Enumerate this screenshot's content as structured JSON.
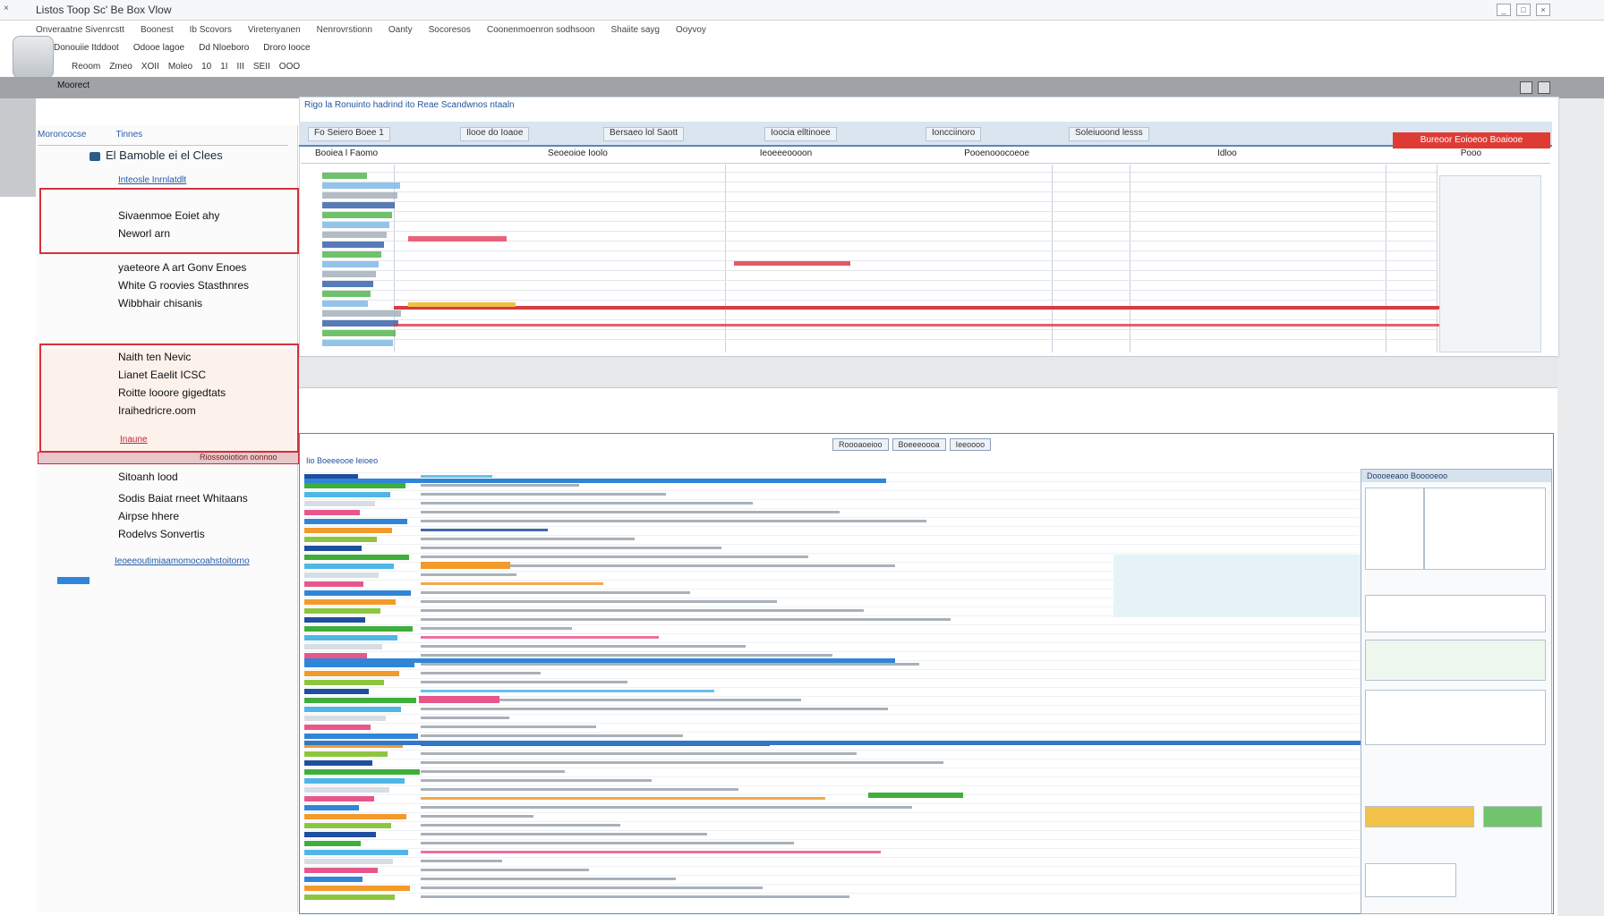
{
  "window": {
    "title": "Listos Toop Sc' Be Box Vlow",
    "controls": [
      "_",
      "□",
      "×"
    ]
  },
  "menubar": [
    "Onveraatne Sivenrcstt",
    "Boonest",
    "Ib Scovors",
    "Viretenyanen",
    "Nenrovrstionn",
    "Oanty",
    "Socoresos",
    "Coonenmoenron sodhsoon",
    "Shaiite sayg",
    "Ooyvoy"
  ],
  "toolbar2": [
    "Donouiie Itddoot",
    "Odooe lagoe",
    "Dd Nloeboro",
    "Droro Iooce"
  ],
  "toolbar3": [
    "Reoom",
    "Zmeo",
    "XOII",
    "Moleo",
    "10",
    "1I",
    "III",
    "SEII",
    "OOO"
  ],
  "graybar": {
    "label": "Moorect"
  },
  "nav": {
    "tabs": [
      "Moroncocse",
      "Tinnes"
    ],
    "header": "El Bamoble ei el Clees",
    "top_link": "Inteosle Inrnlatdlt",
    "group1": [
      "Sivaenmoe Eoiet ahy",
      "Neworl arn"
    ],
    "group2": [
      "yaeteore A art Gonv Enoes",
      "White G roovies Stasthnres",
      "Wibbhair chisanis"
    ],
    "group3": [
      "Naith ten Nevic",
      "Lianet Eaelit ICSC",
      "Roitte looore gigedtats",
      "Iraihedricre.oom"
    ],
    "red_link": "Inaune",
    "red_row": "Riossooiotion oonnoo",
    "group4": [
      "Sitoanh lood",
      "Sodis Baiat rneet Whitaans",
      "Airpse hhere",
      "Rodelvs Sonvertis"
    ],
    "bottom_link": "Ieoeeoutimiaamomocoahstoitorno"
  },
  "top": {
    "breadcrumb": "Rigo la Ronuinto hadrind ito Reae Scandwnos ntaaln",
    "tabs": [
      "Fo Seiero Boee 1",
      "Ilooe do Ioaoe",
      "Bersaeo lol Saott",
      "Ioocia elltinoee",
      "Ioncciinoro",
      "Soleiuoond lesss"
    ],
    "alert": "Bureoor Eoioeoo Boaiooe",
    "columns": [
      "Booiea l Faomo",
      "Seoeoioe Ioolo",
      "Ieoeeeoooon",
      "Pooenooocoeoe",
      "Idloo",
      "Pooo"
    ]
  },
  "lower": {
    "toolbar": [
      "Roooaoeioo",
      "Boeeeoooa",
      "Ieeoooo"
    ],
    "side_title": "Doooeeaoo Booooeoo",
    "section_head": "Iio Boeeeooe Ieioeo"
  },
  "colors": {
    "accent_blue": "#2f86d8",
    "alert_red": "#df3b35",
    "highlight_red": "#d5323c",
    "green": "#3fae3a",
    "navy": "#1f4f9e"
  }
}
